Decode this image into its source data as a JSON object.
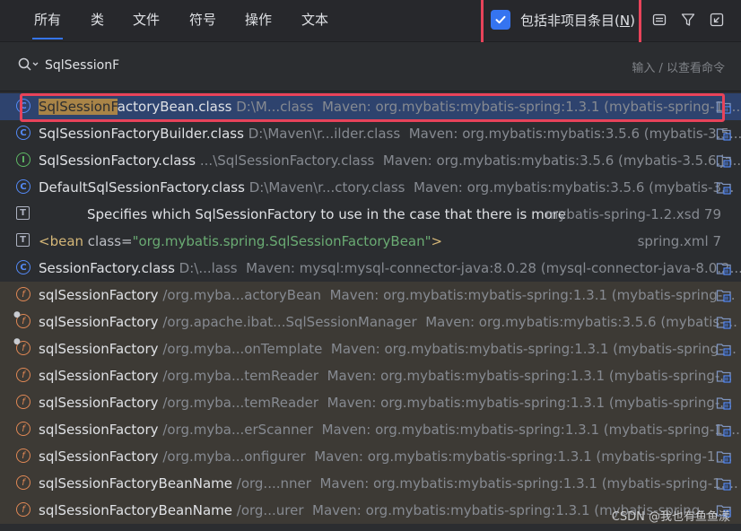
{
  "tabs": [
    {
      "label": "所有",
      "active": true
    },
    {
      "label": "类",
      "active": false
    },
    {
      "label": "文件",
      "active": false
    },
    {
      "label": "符号",
      "active": false
    },
    {
      "label": "操作",
      "active": false
    },
    {
      "label": "文本",
      "active": false
    }
  ],
  "include_non_project": {
    "label": "包括非项目条目(",
    "mnemonic": "N",
    "suffix": ")",
    "checked": true
  },
  "toolbar_icons": [
    "preview-icon",
    "filter-icon",
    "open-in-window-icon"
  ],
  "search": {
    "value": "SqlSessionF",
    "placeholder_hint": "输入 / 以查看命令"
  },
  "results": [
    {
      "icon": "class",
      "highlight": "SqlSessionF",
      "name_rest": "actoryBean.class",
      "path": "D:\\M...class",
      "location": "Maven: org.mybatis:mybatis-spring:1.3.1 (mybatis-spring-1....",
      "selected": true,
      "lib": false
    },
    {
      "icon": "class",
      "highlight": "",
      "name_rest": "SqlSessionFactoryBuilder.class",
      "path": "D:\\Maven\\r...ilder.class",
      "location": "Maven: org.mybatis:mybatis:3.5.6 (mybatis-3.5...",
      "selected": false,
      "lib": false
    },
    {
      "icon": "interface",
      "highlight": "",
      "name_rest": "SqlSessionFactory.class",
      "path": "...\\SqlSessionFactory.class",
      "location": "Maven: org.mybatis:mybatis:3.5.6 (mybatis-3.5.6.ja...",
      "selected": false,
      "lib": false
    },
    {
      "icon": "class",
      "highlight": "",
      "name_rest": "DefaultSqlSessionFactory.class",
      "path": "D:\\Maven\\r...ctory.class",
      "location": "Maven: org.mybatis:mybatis:3.5.6 (mybatis-3...",
      "selected": false,
      "lib": false
    },
    {
      "icon": "text",
      "text": "Specifies which SqlSessionFactory to use in the case that there is more",
      "right": "mybatis-spring-1.2.xsd 79"
    },
    {
      "icon": "text",
      "xml": {
        "open": "<bean ",
        "attr": "class=",
        "value": "\"org.mybatis.spring.SqlSessionFactoryBean\"",
        "close": ">"
      },
      "right": "spring.xml 7"
    },
    {
      "icon": "class",
      "highlight": "",
      "name_rest": "SessionFactory.class",
      "path": "D:\\...lass",
      "location": "Maven: mysql:mysql-connector-java:8.0.28 (mysql-connector-java-8.0.2...",
      "selected": false,
      "lib": false
    },
    {
      "icon": "field",
      "highlight": "",
      "name_rest": "sqlSessionFactory",
      "path": "/org.myba...actoryBean",
      "location": "Maven: org.mybatis:mybatis-spring:1.3.1 (mybatis-spring-...",
      "selected": false,
      "lib": true
    },
    {
      "icon": "field-locked",
      "highlight": "",
      "name_rest": "sqlSessionFactory",
      "path": "/org.apache.ibat...SqlSessionManager",
      "location": "Maven: org.mybatis:mybatis:3.5.6 (mybatis-...",
      "selected": false,
      "lib": true
    },
    {
      "icon": "field-locked",
      "highlight": "",
      "name_rest": "sqlSessionFactory",
      "path": "/org.myba...onTemplate",
      "location": "Maven: org.mybatis:mybatis-spring:1.3.1 (mybatis-spring-...",
      "selected": false,
      "lib": true
    },
    {
      "icon": "field",
      "highlight": "",
      "name_rest": "sqlSessionFactory",
      "path": "/org.myba...temReader",
      "location": "Maven: org.mybatis:mybatis-spring:1.3.1 (mybatis-spring-...",
      "selected": false,
      "lib": true
    },
    {
      "icon": "field",
      "highlight": "",
      "name_rest": "sqlSessionFactory",
      "path": "/org.myba...temReader",
      "location": "Maven: org.mybatis:mybatis-spring:1.3.1 (mybatis-spring-...",
      "selected": false,
      "lib": true
    },
    {
      "icon": "field",
      "highlight": "",
      "name_rest": "sqlSessionFactory",
      "path": "/org.myba...erScanner",
      "location": "Maven: org.mybatis:mybatis-spring:1.3.1 (mybatis-spring-1....",
      "selected": false,
      "lib": true
    },
    {
      "icon": "field",
      "highlight": "",
      "name_rest": "sqlSessionFactory",
      "path": "/org.myba...onfigurer",
      "location": "Maven: org.mybatis:mybatis-spring:1.3.1 (mybatis-spring-1....",
      "selected": false,
      "lib": true
    },
    {
      "icon": "field",
      "highlight": "",
      "name_rest": "sqlSessionFactoryBeanName",
      "path": "/org....nner",
      "location": "Maven: org.mybatis:mybatis-spring:1.3.1 (mybatis-spring-1....",
      "selected": false,
      "lib": true
    },
    {
      "icon": "field",
      "highlight": "",
      "name_rest": "sqlSessionFactoryBeanName",
      "path": "/org...urer",
      "location": "Maven: org.mybatis:mybatis-spring:1.3.1 (mybatis-spring-...",
      "selected": false,
      "lib": true
    }
  ],
  "watermark": "CSDN @我也有鱼鱼漾",
  "colors": {
    "accent": "#3574f0",
    "highlight_bg": "#a98447",
    "annotation_red": "#e8435a",
    "selected_row": "#2e436e",
    "library_row": "#3d3a35"
  }
}
